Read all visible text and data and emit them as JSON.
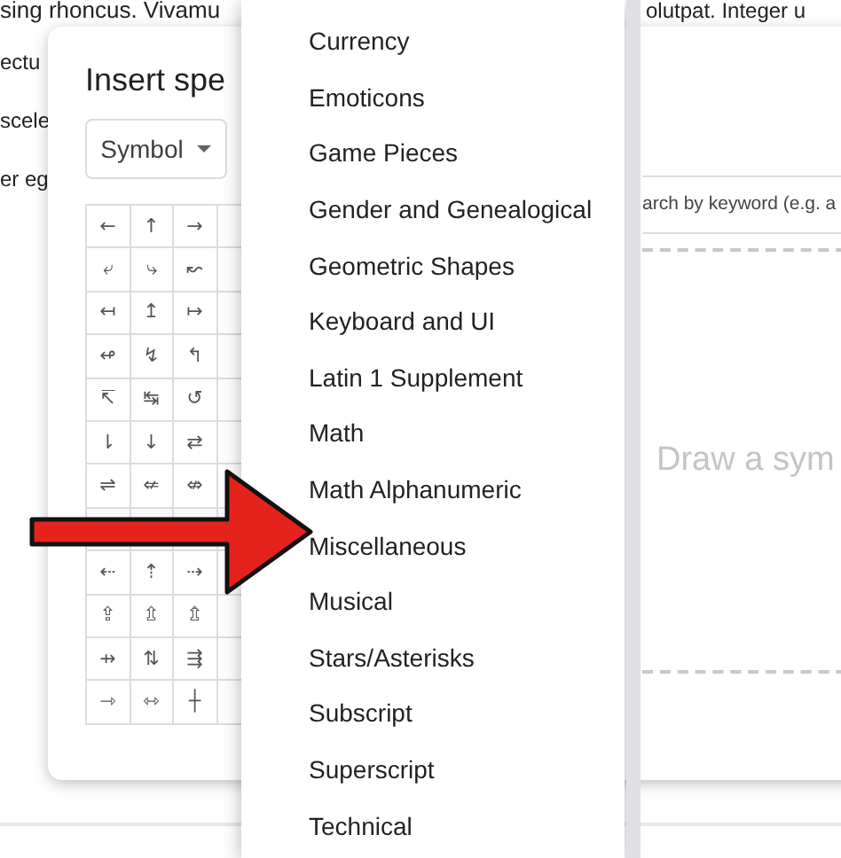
{
  "document": {
    "left_lines": [
      "sing rhoncus. Vivamu",
      "ectu",
      "scele",
      "er eg"
    ],
    "right_line": "olutpat. Integer u"
  },
  "dialog": {
    "title": "Insert spe",
    "category_dropdown": {
      "value": "Symbol"
    },
    "symbol_rows": [
      {
        "covered": false,
        "cells": [
          "←",
          "↑",
          "→"
        ]
      },
      {
        "covered": false,
        "cells": [
          "⤶",
          "⤷",
          "↜"
        ]
      },
      {
        "covered": false,
        "cells": [
          "↤",
          "↥",
          "↦"
        ]
      },
      {
        "covered": false,
        "cells": [
          "↫",
          "↯",
          "↰"
        ]
      },
      {
        "covered": false,
        "cells": [
          "↸",
          "↹",
          "↺"
        ]
      },
      {
        "covered": false,
        "cells": [
          "⇂",
          "↓",
          "⇄"
        ]
      },
      {
        "covered": false,
        "cells": [
          "⇌",
          "⇍",
          "⇎"
        ]
      },
      {
        "covered": true
      },
      {
        "covered": false,
        "cells": [
          "⇠",
          "⇡",
          "⇢"
        ]
      },
      {
        "covered": false,
        "cells": [
          "⇪",
          "⇫",
          "⇬"
        ]
      },
      {
        "covered": false,
        "cells": [
          "⇸",
          "⇅",
          "⇶"
        ]
      },
      {
        "covered": false,
        "cells": [
          "⇾",
          "⇿",
          "┼"
        ]
      }
    ],
    "search": {
      "placeholder": "arch by keyword (e.g. a"
    },
    "draw_area": {
      "placeholder": "Draw a sym"
    }
  },
  "menu": {
    "items": [
      {
        "label": "Currency"
      },
      {
        "label": "Emoticons"
      },
      {
        "label": "Game Pieces"
      },
      {
        "label": "Gender and Genealogical"
      },
      {
        "label": "Geometric Shapes"
      },
      {
        "label": "Keyboard and UI"
      },
      {
        "label": "Latin 1 Supplement"
      },
      {
        "label": "Math"
      },
      {
        "label": "Math Alphanumeric"
      },
      {
        "label": "Miscellaneous"
      },
      {
        "label": "Musical"
      },
      {
        "label": "Stars/Asterisks"
      },
      {
        "label": "Subscript"
      },
      {
        "label": "Superscript"
      },
      {
        "label": "Technical"
      }
    ]
  }
}
